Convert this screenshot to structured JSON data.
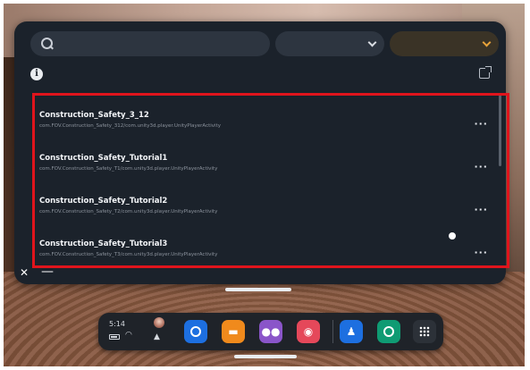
{
  "search": {
    "placeholder": ""
  },
  "sort_dropdown": {
    "label": ""
  },
  "filter_dropdown": {
    "label": ""
  },
  "notice": {
    "text": ""
  },
  "apps": [
    {
      "title": "Construction_Safety_3_12",
      "package": "com.FOV.Construction_Safety_312/com.unity3d.player.UnityPlayerActivity"
    },
    {
      "title": "Construction_Safety_Tutorial1",
      "package": "com.FOV.Construction_Safety_T1/com.unity3d.player.UnityPlayerActivity"
    },
    {
      "title": "Construction_Safety_Tutorial2",
      "package": "com.FOV.Construction_Safety_T2/com.unity3d.player.UnityPlayerActivity"
    },
    {
      "title": "Construction_Safety_Tutorial3",
      "package": "com.FOV.Construction_Safety_T3/com.unity3d.player.UnityPlayerActivity"
    }
  ],
  "more_label": "···",
  "footer": {
    "close": "✕",
    "minimize": "—",
    "title": ""
  },
  "taskbar": {
    "time": "5:14",
    "wifi_glyph": "◠",
    "bell_glyph": "▲",
    "apps": [
      "compass-icon",
      "store-icon",
      "people-icon",
      "camera-icon",
      "social-icon",
      "tv-icon",
      "app-grid-icon"
    ]
  },
  "colors": {
    "highlight": "#e0141c",
    "filter_accent": "#e8a33a",
    "panel": "#1b222b"
  }
}
